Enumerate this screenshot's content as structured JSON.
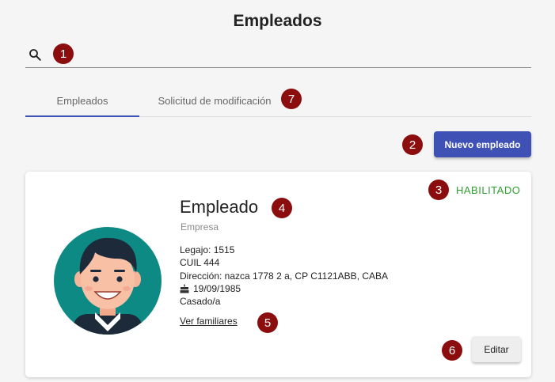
{
  "page": {
    "title": "Empleados"
  },
  "search": {
    "value": "",
    "placeholder": ""
  },
  "tabs": [
    {
      "label": "Empleados",
      "active": true
    },
    {
      "label": "Solicitud de modificación",
      "active": false
    }
  ],
  "actions": {
    "new_employee_label": "Nuevo empleado"
  },
  "employee": {
    "status": "HABILITADO",
    "name": "Empleado",
    "company": "Empresa",
    "legajo": "Legajo: 1515",
    "cuil": "CUIL 444",
    "address": "Dirección: nazca 1778 2 a, CP C1121ABB, CABA",
    "birthdate": "19/09/1985",
    "marital_status": "Casado/a",
    "family_link": "Ver familiares",
    "edit_label": "Editar"
  },
  "badges": [
    "1",
    "2",
    "3",
    "4",
    "5",
    "6",
    "7"
  ],
  "colors": {
    "primary": "#3f51b5",
    "status_enabled": "#2e9e2e",
    "badge": "#8b0d0d",
    "avatar_bg": "#0e8a84"
  },
  "icons": {
    "search": "search-icon",
    "birthdate": "cake-icon",
    "avatar": "avatar-icon"
  }
}
